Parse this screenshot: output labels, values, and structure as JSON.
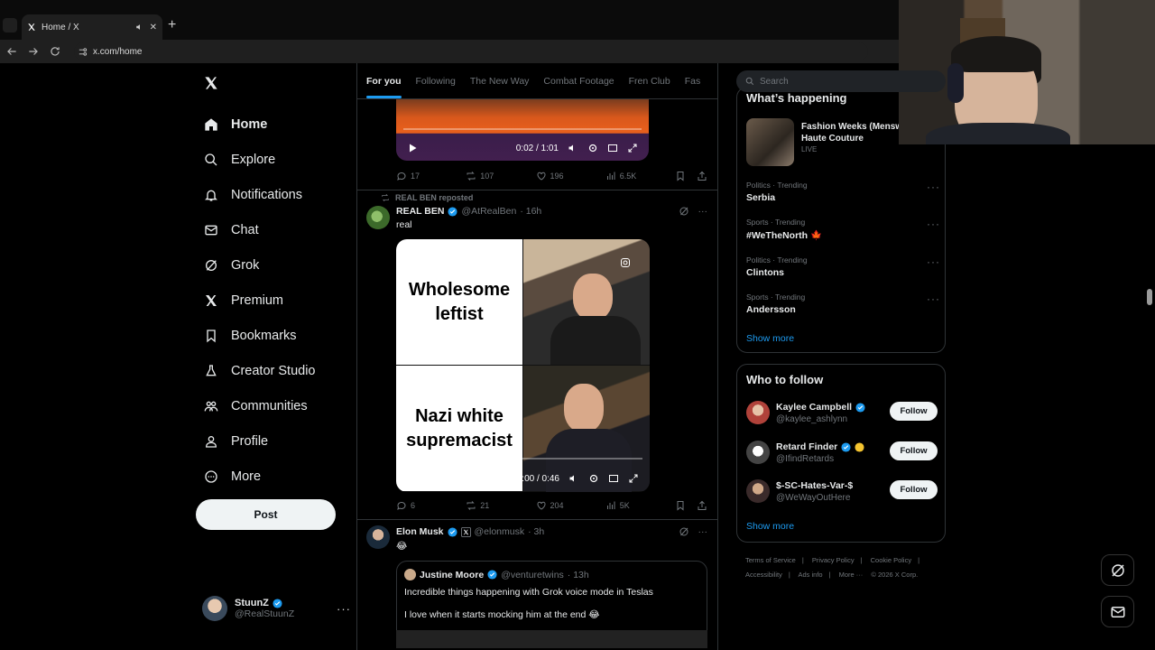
{
  "browser": {
    "tab_title": "Home / X",
    "url": "x.com/home"
  },
  "nav": {
    "items": [
      {
        "label": "Home",
        "icon": "home-icon"
      },
      {
        "label": "Explore",
        "icon": "search-icon"
      },
      {
        "label": "Notifications",
        "icon": "bell-icon"
      },
      {
        "label": "Chat",
        "icon": "mail-icon"
      },
      {
        "label": "Grok",
        "icon": "grok-icon"
      },
      {
        "label": "Premium",
        "icon": "x-icon"
      },
      {
        "label": "Bookmarks",
        "icon": "bookmark-icon"
      },
      {
        "label": "Creator Studio",
        "icon": "flask-icon"
      },
      {
        "label": "Communities",
        "icon": "people-icon"
      },
      {
        "label": "Profile",
        "icon": "person-icon"
      },
      {
        "label": "More",
        "icon": "more-circle-icon"
      }
    ],
    "post_label": "Post"
  },
  "account": {
    "name": "StuunZ",
    "handle": "@RealStuunZ"
  },
  "feed": {
    "tabs": [
      "For you",
      "Following",
      "The New Way",
      "Combat Footage",
      "Fren Club",
      "Fas"
    ],
    "tweet1": {
      "video_time": "0:02 / 1:01",
      "replies": "17",
      "reposts": "107",
      "likes": "196",
      "views": "6.5K"
    },
    "tweet2": {
      "repost_by": "REAL BEN reposted",
      "name": "REAL BEN",
      "handle": "@AtRealBen",
      "time": "· 16h",
      "text": "real",
      "caption_top": "Wholesome leftist",
      "caption_bottom": "Nazi white supremacist",
      "video_time": "0:00 / 0:46",
      "replies": "6",
      "reposts": "21",
      "likes": "204",
      "views": "5K"
    },
    "tweet3": {
      "name": "Elon Musk",
      "handle": "@elonmusk",
      "time": "· 3h",
      "text": "😂",
      "quote": {
        "name": "Justine Moore",
        "handle": "@venturetwins",
        "time": "· 13h",
        "line1": "Incredible things happening with Grok voice mode in Teslas",
        "line2": "I love when it starts mocking him at the end 😂"
      }
    }
  },
  "sidebar": {
    "search_placeholder": "Search",
    "happening_title": "What’s happening",
    "live": {
      "title": "Fashion Weeks (Mensw FW26 & Haute Couture",
      "status": "LIVE"
    },
    "trends": [
      {
        "category": "Politics · Trending",
        "topic": "Serbia"
      },
      {
        "category": "Sports · Trending",
        "topic": "#WeTheNorth 🍁"
      },
      {
        "category": "Politics · Trending",
        "topic": "Clintons"
      },
      {
        "category": "Sports · Trending",
        "topic": "Andersson"
      }
    ],
    "show_more": "Show more",
    "wtf_title": "Who to follow",
    "follows": [
      {
        "name": "Kaylee Campbell",
        "handle": "@kaylee_ashlynn",
        "button": "Follow"
      },
      {
        "name": "Retard Finder",
        "handle": "@IfindRetards",
        "button": "Follow"
      },
      {
        "name": "$-SC-Hates-Var-$",
        "handle": "@WeWayOutHere",
        "button": "Follow"
      }
    ],
    "show_more_2": "Show more",
    "footer": [
      "Terms of Service",
      "|",
      "Privacy Policy",
      "|",
      "Cookie Policy",
      "|",
      "Accessibility",
      "|",
      "Ads info",
      "|",
      "More ···",
      "© 2026 X Corp."
    ]
  },
  "colors": {
    "accent": "#1d9bf0",
    "background": "#000000",
    "border": "#2f3336",
    "muted": "#71767b"
  }
}
